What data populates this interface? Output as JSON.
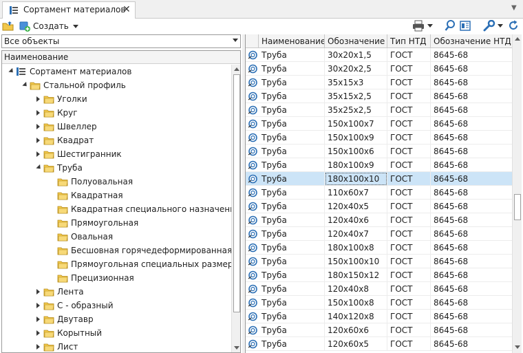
{
  "tab": {
    "title": "Сортамент материалов",
    "close": "✕"
  },
  "toolbar": {
    "create_label": "Создать"
  },
  "filter": {
    "value": "Все объекты"
  },
  "tree": {
    "header": "Наименование",
    "nodes": [
      {
        "label": "Сортамент материалов",
        "level": 0,
        "expander": "down",
        "icon": "catalog"
      },
      {
        "label": "Стальной профиль",
        "level": 1,
        "expander": "down",
        "icon": "folder"
      },
      {
        "label": "Уголки",
        "level": 2,
        "expander": "right",
        "icon": "folder"
      },
      {
        "label": "Круг",
        "level": 2,
        "expander": "right",
        "icon": "folder"
      },
      {
        "label": "Швеллер",
        "level": 2,
        "expander": "right",
        "icon": "folder"
      },
      {
        "label": "Квадрат",
        "level": 2,
        "expander": "right",
        "icon": "folder"
      },
      {
        "label": "Шестигранник",
        "level": 2,
        "expander": "right",
        "icon": "folder"
      },
      {
        "label": "Труба",
        "level": 2,
        "expander": "down",
        "icon": "folder"
      },
      {
        "label": "Полуовальная",
        "level": 3,
        "expander": "none",
        "icon": "folder"
      },
      {
        "label": "Квадратная",
        "level": 3,
        "expander": "none",
        "icon": "folder"
      },
      {
        "label": "Квадратная специального назначения",
        "level": 3,
        "expander": "none",
        "icon": "folder"
      },
      {
        "label": "Прямоугольная",
        "level": 3,
        "expander": "none",
        "icon": "folder"
      },
      {
        "label": "Овальная",
        "level": 3,
        "expander": "none",
        "icon": "folder"
      },
      {
        "label": "Бесшовная горячедеформированная",
        "level": 3,
        "expander": "none",
        "icon": "folder"
      },
      {
        "label": "Прямоугольная специальных размеров",
        "level": 3,
        "expander": "none",
        "icon": "folder"
      },
      {
        "label": "Прецизионная",
        "level": 3,
        "expander": "none",
        "icon": "folder"
      },
      {
        "label": "Лента",
        "level": 2,
        "expander": "right",
        "icon": "folder"
      },
      {
        "label": "С - образный",
        "level": 2,
        "expander": "right",
        "icon": "folder"
      },
      {
        "label": "Двутавр",
        "level": 2,
        "expander": "right",
        "icon": "folder"
      },
      {
        "label": "Корытный",
        "level": 2,
        "expander": "right",
        "icon": "folder"
      },
      {
        "label": "Лист",
        "level": 2,
        "expander": "right",
        "icon": "folder"
      }
    ]
  },
  "grid": {
    "columns": [
      "Наименование",
      "Обозначение",
      "Тип НТД",
      "Обозначение НТД"
    ],
    "selected_index": 9,
    "rows": [
      [
        "Труба",
        "30x20x1,5",
        "ГОСТ",
        "8645-68"
      ],
      [
        "Труба",
        "30x20x2,5",
        "ГОСТ",
        "8645-68"
      ],
      [
        "Труба",
        "35x15x3",
        "ГОСТ",
        "8645-68"
      ],
      [
        "Труба",
        "35x15x2,5",
        "ГОСТ",
        "8645-68"
      ],
      [
        "Труба",
        "35x25x2,5",
        "ГОСТ",
        "8645-68"
      ],
      [
        "Труба",
        "150x100x7",
        "ГОСТ",
        "8645-68"
      ],
      [
        "Труба",
        "150x100x9",
        "ГОСТ",
        "8645-68"
      ],
      [
        "Труба",
        "150x100x6",
        "ГОСТ",
        "8645-68"
      ],
      [
        "Труба",
        "180x100x9",
        "ГОСТ",
        "8645-68"
      ],
      [
        "Труба",
        "180x100x10",
        "ГОСТ",
        "8645-68"
      ],
      [
        "Труба",
        "110x60x7",
        "ГОСТ",
        "8645-68"
      ],
      [
        "Труба",
        "120x40x5",
        "ГОСТ",
        "8645-68"
      ],
      [
        "Труба",
        "120x40x6",
        "ГОСТ",
        "8645-68"
      ],
      [
        "Труба",
        "120x40x7",
        "ГОСТ",
        "8645-68"
      ],
      [
        "Труба",
        "180x100x8",
        "ГОСТ",
        "8645-68"
      ],
      [
        "Труба",
        "150x100x10",
        "ГОСТ",
        "8645-68"
      ],
      [
        "Труба",
        "180x150x12",
        "ГОСТ",
        "8645-68"
      ],
      [
        "Труба",
        "120x40x8",
        "ГОСТ",
        "8645-68"
      ],
      [
        "Труба",
        "150x100x8",
        "ГОСТ",
        "8645-68"
      ],
      [
        "Труба",
        "140x120x8",
        "ГОСТ",
        "8645-68"
      ],
      [
        "Труба",
        "120x60x6",
        "ГОСТ",
        "8645-68"
      ],
      [
        "Труба",
        "120x60x5",
        "ГОСТ",
        "8645-68"
      ]
    ]
  },
  "colors": {
    "selection": "#cce4f7",
    "folder": "#f2c84b",
    "accent": "#2b6fb5"
  }
}
